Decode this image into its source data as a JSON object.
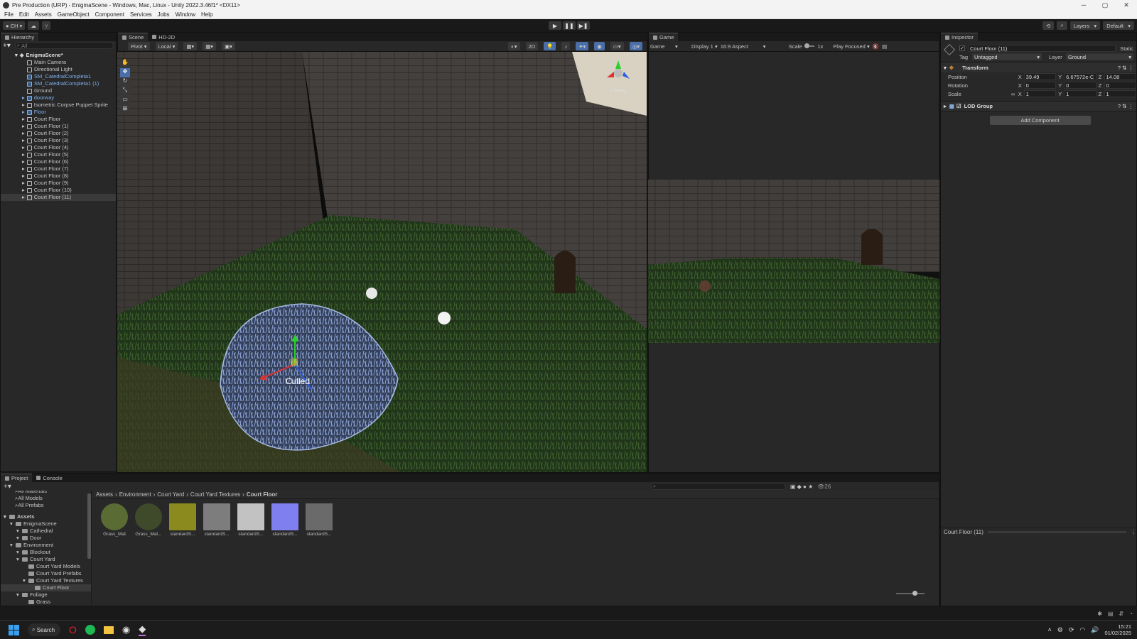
{
  "window": {
    "title": "Pre Production (URP) - EnigmaScene - Windows, Mac, Linux - Unity 2022.3.46f1* <DX11>"
  },
  "menu": [
    "File",
    "Edit",
    "Assets",
    "GameObject",
    "Component",
    "Services",
    "Jobs",
    "Window",
    "Help"
  ],
  "toolbar": {
    "account": "CH",
    "layers": "Layers",
    "layout": "Default"
  },
  "hierarchy": {
    "tab": "Hierarchy",
    "search_placeholder": "All",
    "scene": "EnigmaScene*",
    "items": [
      {
        "label": "Main Camera",
        "prefab": false
      },
      {
        "label": "Directional Light",
        "prefab": false
      },
      {
        "label": "SM_CatedralCompleta1",
        "prefab": true
      },
      {
        "label": "SM_CatedralCompleta1 (1)",
        "prefab": true
      },
      {
        "label": "Ground",
        "prefab": false
      },
      {
        "label": "doorway",
        "prefab": true
      },
      {
        "label": "Isometric Corpse Puppet Sprite",
        "prefab": false
      },
      {
        "label": "Floor",
        "prefab": true
      },
      {
        "label": "Court Floor",
        "prefab": false
      },
      {
        "label": "Court Floor (1)",
        "prefab": false
      },
      {
        "label": "Court Floor (2)",
        "prefab": false
      },
      {
        "label": "Court Floor (3)",
        "prefab": false
      },
      {
        "label": "Court Floor (4)",
        "prefab": false
      },
      {
        "label": "Court Floor (5)",
        "prefab": false
      },
      {
        "label": "Court Floor (6)",
        "prefab": false
      },
      {
        "label": "Court Floor (7)",
        "prefab": false
      },
      {
        "label": "Court Floor (8)",
        "prefab": false
      },
      {
        "label": "Court Floor (9)",
        "prefab": false
      },
      {
        "label": "Court Floor (10)",
        "prefab": false
      },
      {
        "label": "Court Floor (11)",
        "prefab": false
      }
    ]
  },
  "scene_view": {
    "tabs": [
      "Scene",
      "HD-2D"
    ],
    "pivot": "Pivot",
    "local": "Local",
    "mode_2d": "2D",
    "persp": "< Persp",
    "culled_label": "Culled"
  },
  "game_view": {
    "tab": "Game",
    "game": "Game",
    "display": "Display 1",
    "aspect": "16:9 Aspect",
    "scale_label": "Scale",
    "scale_value": "1x",
    "play_mode": "Play Focused"
  },
  "inspector": {
    "tab": "Inspector",
    "object_name": "Court Floor (11)",
    "static": "Static",
    "tag_label": "Tag",
    "tag": "Untagged",
    "layer_label": "Layer",
    "layer": "Ground",
    "transform": {
      "title": "Transform",
      "position_label": "Position",
      "rotation_label": "Rotation",
      "scale_label": "Scale",
      "position": {
        "x": "39.49",
        "y": "6.67572e-C",
        "z": "14.08"
      },
      "rotation": {
        "x": "0",
        "y": "0",
        "z": "0"
      },
      "scale": {
        "x": "1",
        "y": "1",
        "z": "1"
      }
    },
    "lod_group": "LOD Group",
    "add_component": "Add Component",
    "footer": "Court Floor (11)"
  },
  "project": {
    "tabs": [
      "Project",
      "Console"
    ],
    "count": "26",
    "favorites": [
      "All Materials",
      "All Models",
      "All Prefabs"
    ],
    "tree": [
      {
        "label": "Assets",
        "depth": 0,
        "bold": true
      },
      {
        "label": "EnigmaScene",
        "depth": 1
      },
      {
        "label": "Cathedral",
        "depth": 2
      },
      {
        "label": "Door",
        "depth": 2
      },
      {
        "label": "Environment",
        "depth": 1
      },
      {
        "label": "Blockout",
        "depth": 2
      },
      {
        "label": "Court Yard",
        "depth": 2
      },
      {
        "label": "Court Yard Models",
        "depth": 3
      },
      {
        "label": "Court Yard Prefabs",
        "depth": 3
      },
      {
        "label": "Court Yard Textures",
        "depth": 3
      },
      {
        "label": "Court Floor",
        "depth": 4,
        "selected": true
      },
      {
        "label": "Foliage",
        "depth": 2
      },
      {
        "label": "Grass",
        "depth": 3
      }
    ],
    "breadcrumb": [
      "Assets",
      "Environment",
      "Court Yard",
      "Court Yard Textures",
      "Court Floor"
    ],
    "assets": [
      {
        "label": "Grass_Mat",
        "color": "#5a6b34"
      },
      {
        "label": "Grass_Mat...",
        "color": "#3f4a2a"
      },
      {
        "label": "standardS...",
        "color": "#8a8a1e"
      },
      {
        "label": "standardS...",
        "color": "#7d7d7d"
      },
      {
        "label": "standardS...",
        "color": "#c2c2c2"
      },
      {
        "label": "standardS...",
        "color": "#7f7ff0"
      },
      {
        "label": "standardS...",
        "color": "#6a6a6a"
      }
    ]
  },
  "taskbar": {
    "search": "Search",
    "time": "15:21",
    "date": "01/02/2025"
  }
}
